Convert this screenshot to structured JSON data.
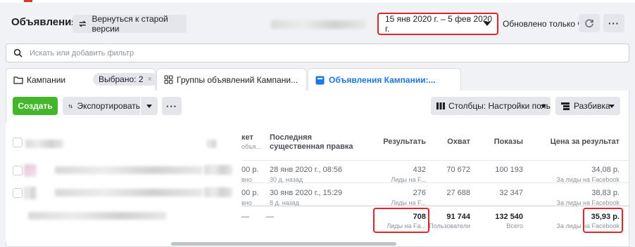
{
  "header": {
    "title": "Объявления",
    "old_version_label": "Вернуться к старой версии",
    "date_range": "15 янв 2020 г. – 5 фев 2020 г.",
    "updated_label": "Обновлено только что"
  },
  "search": {
    "placeholder": "Искать или добавить фильтр"
  },
  "tabs": [
    {
      "label": "Кампании",
      "chip": "Выбрано: 2"
    },
    {
      "label": "Группы объявлений Кампани..."
    },
    {
      "label": "Объявления Кампании:..."
    }
  ],
  "toolbar": {
    "create_label": "Создать",
    "export_label": "Экспортировать",
    "columns_label": "Столбцы: Настройки польз",
    "breakdown_label": "Разбивка"
  },
  "table": {
    "partial_header_1": "кет",
    "partial_header_2": "объя...",
    "col_edit": "Последняя существенная правка",
    "col_results": "Результать",
    "col_reach": "Охват",
    "col_impressions": "Показы",
    "col_cost": "Цена за результат",
    "rows": [
      {
        "budget": "00 р.",
        "budget_sub": "вно",
        "edit": "28 янв 2020 г., 08:56",
        "edit_sub": "30 д. назад",
        "results": "432",
        "results_sub": "Лиды на F...",
        "reach": "70 672",
        "impressions": "100 193",
        "cost": "34,08 р.",
        "cost_sub": "За лиды на Facebook"
      },
      {
        "budget": "00 р.",
        "budget_sub": "вно",
        "edit": "30 янв 2020 г., 15:29",
        "edit_sub": "8 д. назад",
        "results": "276",
        "results_sub": "Лиды на F...",
        "reach": "27 688",
        "impressions": "32 347",
        "cost": "38,83 р.",
        "cost_sub": "За лиды на Facebook"
      }
    ],
    "totals": {
      "budget": "—",
      "edit": "—",
      "results": "708",
      "results_sub": "Лиды на Fa...",
      "reach": "91 744",
      "reach_sub": "Пользователи",
      "impressions": "132 540",
      "impressions_sub": "Всего",
      "cost": "35,93 р.",
      "cost_sub": "За лиды на Facebook"
    }
  },
  "colors": {
    "accent": "#1877f2",
    "create": "#42b72a",
    "highlight": "#e0242a"
  }
}
